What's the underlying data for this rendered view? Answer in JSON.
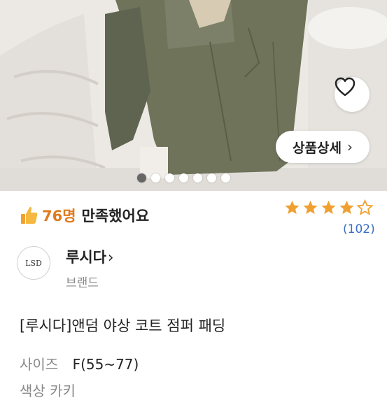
{
  "photo": {
    "alt_icon": "product-photo",
    "dots_total": 7,
    "active_dot": 0
  },
  "buttons": {
    "wishlist_icon": "heart-icon",
    "detail_label": "상품상세",
    "detail_chevron": "›"
  },
  "satisfaction": {
    "icon": "thumbs-up-icon",
    "count": "76명",
    "text": "만족했어요"
  },
  "rating": {
    "stars": 4,
    "max_stars": 5,
    "review_count": "(102)"
  },
  "brand": {
    "name": "루시다",
    "chevron": "›",
    "sub": "브랜드",
    "logo_text": "LSD"
  },
  "product": {
    "title": "[루시다]앤덤 야상 코트 점퍼 패딩"
  },
  "spec": {
    "size_label": "사이즈",
    "size_value": "F(55~77)",
    "next_row": "색상   카키"
  },
  "colors": {
    "accent_orange": "#e07a1f",
    "star": "#f0a030",
    "link_blue": "#3a6fc4"
  }
}
